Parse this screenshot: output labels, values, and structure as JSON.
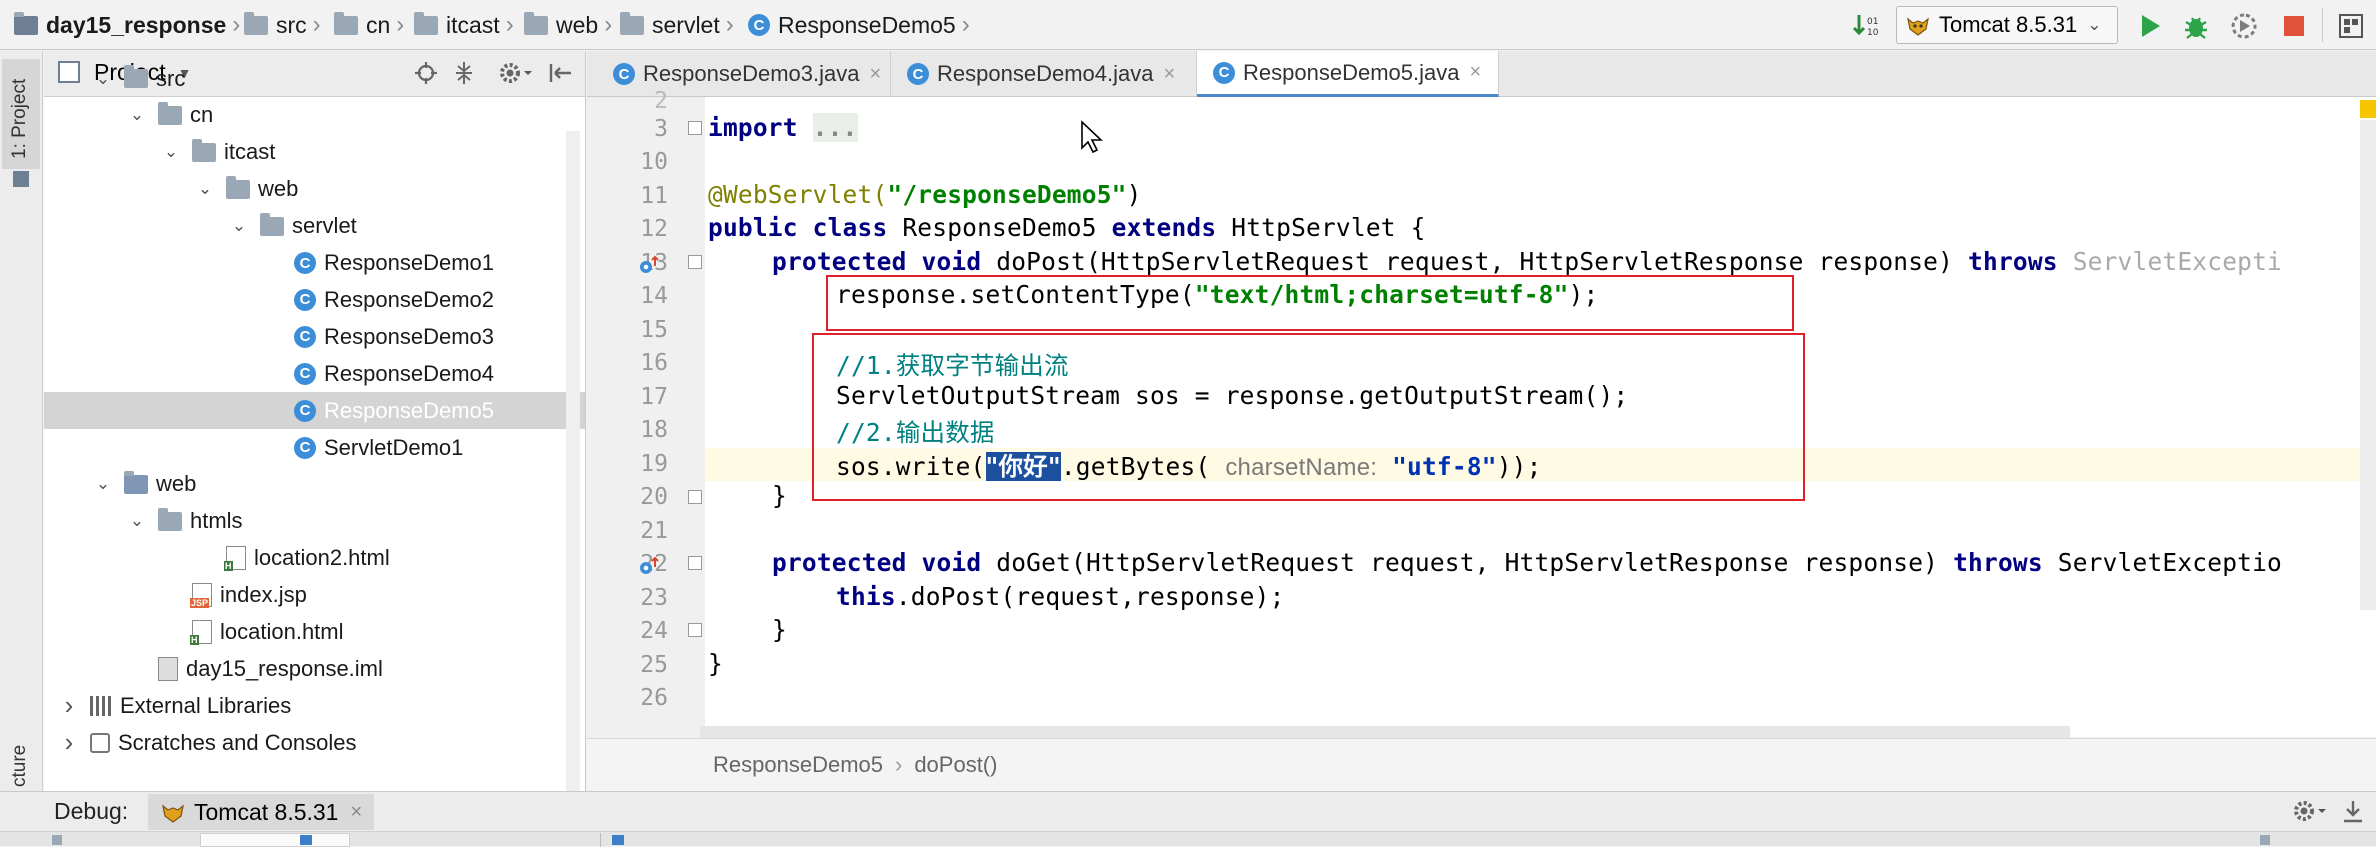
{
  "navbar": {
    "breadcrumbs": [
      "day15_response",
      "src",
      "cn",
      "itcast",
      "web",
      "servlet",
      "ResponseDemo5"
    ],
    "run_config": "Tomcat 8.5.31"
  },
  "left_stripe": {
    "project_tab": "1: Project",
    "structure_tab": "cture"
  },
  "project": {
    "header": "Project",
    "tree": [
      {
        "label": "src",
        "indent": 1,
        "type": "folder",
        "arrow": "v"
      },
      {
        "label": "cn",
        "indent": 2,
        "type": "folder",
        "arrow": "v"
      },
      {
        "label": "itcast",
        "indent": 3,
        "type": "folder",
        "arrow": "v"
      },
      {
        "label": "web",
        "indent": 4,
        "type": "folder",
        "arrow": "v"
      },
      {
        "label": "servlet",
        "indent": 5,
        "type": "folder",
        "arrow": "v"
      },
      {
        "label": "ResponseDemo1",
        "indent": 6,
        "type": "class"
      },
      {
        "label": "ResponseDemo2",
        "indent": 6,
        "type": "class"
      },
      {
        "label": "ResponseDemo3",
        "indent": 6,
        "type": "class"
      },
      {
        "label": "ResponseDemo4",
        "indent": 6,
        "type": "class"
      },
      {
        "label": "ResponseDemo5",
        "indent": 6,
        "type": "class",
        "selected": true
      },
      {
        "label": "ServletDemo1",
        "indent": 6,
        "type": "class"
      },
      {
        "label": "web",
        "indent": 1,
        "type": "webfolder",
        "arrow": "v"
      },
      {
        "label": "htmls",
        "indent": 2,
        "type": "folder",
        "arrow": "v"
      },
      {
        "label": "location2.html",
        "indent": 4,
        "type": "html"
      },
      {
        "label": "index.jsp",
        "indent": 3,
        "type": "jsp"
      },
      {
        "label": "location.html",
        "indent": 3,
        "type": "html"
      },
      {
        "label": "day15_response.iml",
        "indent": 2,
        "type": "iml"
      },
      {
        "label": "External Libraries",
        "indent": 0,
        "type": "lib",
        "arrow": ">"
      },
      {
        "label": "Scratches and Consoles",
        "indent": 0,
        "type": "scratch",
        "arrow": ">"
      }
    ]
  },
  "tabs": [
    {
      "label": "ResponseDemo3.java",
      "active": false
    },
    {
      "label": "ResponseDemo4.java",
      "active": false
    },
    {
      "label": "ResponseDemo5.java",
      "active": true
    }
  ],
  "editor": {
    "line_numbers": [
      "3",
      "10",
      "11",
      "12",
      "13",
      "14",
      "15",
      "16",
      "17",
      "18",
      "19",
      "20",
      "21",
      "22",
      "23",
      "24",
      "25",
      "26"
    ],
    "code": {
      "l3_kw": "import",
      "l3_rest": "...",
      "l11_ann": "@WebServlet(",
      "l11_str": "\"/responseDemo5\"",
      "l11_end": ")",
      "l12_kw1": "public class",
      "l12_name": "ResponseDemo5",
      "l12_kw2": "extends",
      "l12_rest": "HttpServlet {",
      "l13_kw": "protected void",
      "l13_rest": "doPost(HttpServletRequest request, HttpServletResponse response)",
      "l13_throws": "throws",
      "l13_exc": "ServletExcepti",
      "l14_a": "response.setContentType(",
      "l14_str": "\"text/html;charset=utf-8\"",
      "l14_b": ");",
      "l16_cm": "//1.",
      "l16_cn": "获取字节输出流",
      "l17": "ServletOutputStream sos = response.getOutputStream();",
      "l18_cm": "//2.",
      "l18_cn": "输出数据",
      "l19_a": "sos.write(",
      "l19_sel": "\"你好\"",
      "l19_b": ".getBytes(",
      "l19_hint": "charsetName:",
      "l19_str": "\"utf-8\"",
      "l19_c": "));",
      "l20": "}",
      "l22_kw": "protected void",
      "l22_rest": "doGet(HttpServletRequest request, HttpServletResponse response)",
      "l22_throws": "throws",
      "l22_exc": "ServletExceptio",
      "l23_kw": "this",
      "l23_rest": ".doPost(request,response);",
      "l24": "}",
      "l25": "}"
    },
    "breadcrumb": [
      "ResponseDemo5",
      "doPost()"
    ]
  },
  "debug": {
    "label": "Debug:",
    "config": "Tomcat 8.5.31"
  },
  "colors": {
    "keyword": "#000080",
    "string": "#008000",
    "comment": "#008080",
    "annotation": "#808000",
    "highlight_box": "#e0202a",
    "selection": "#1d4f9f",
    "class_icon": "#3d8ed8"
  }
}
